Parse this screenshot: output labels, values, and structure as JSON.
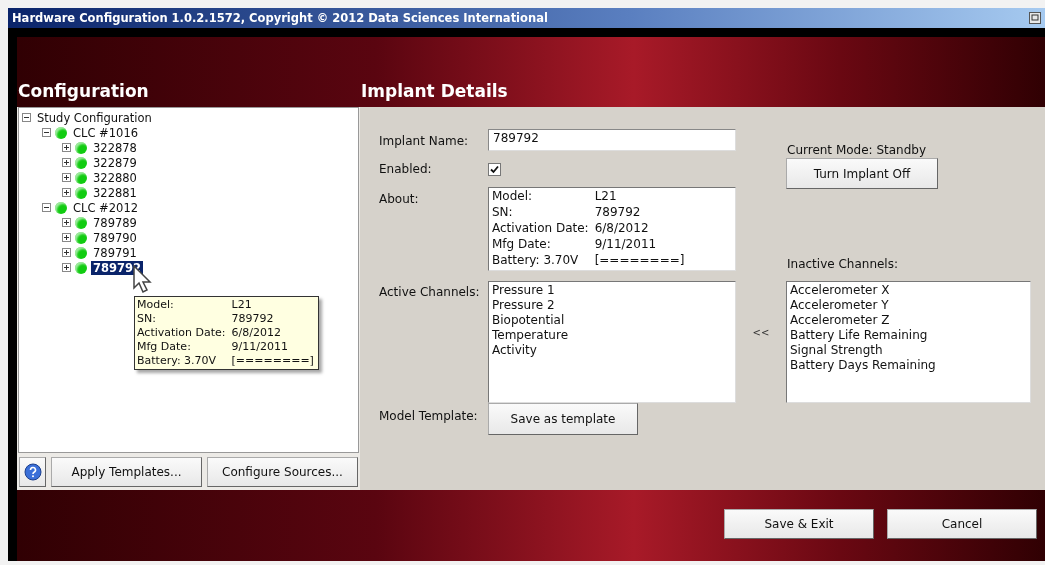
{
  "window": {
    "title": "Hardware Configuration 1.0.2.1572, Copyright © 2012 Data Sciences International"
  },
  "config_heading": "Configuration",
  "details_heading": "Implant Details",
  "tree": [
    {
      "label": "Study Configuration",
      "expanded": true,
      "selected": false,
      "children": [
        {
          "label": "CLC #1016",
          "color": "#11cc11",
          "expanded": true,
          "selected": false,
          "children": [
            {
              "label": "322878",
              "color": "#11cc11",
              "expanded": false,
              "selected": false
            },
            {
              "label": "322879",
              "color": "#11cc11",
              "expanded": false,
              "selected": false
            },
            {
              "label": "322880",
              "color": "#11cc11",
              "expanded": false,
              "selected": false
            },
            {
              "label": "322881",
              "color": "#11cc11",
              "expanded": false,
              "selected": false
            }
          ]
        },
        {
          "label": "CLC #2012",
          "color": "#11cc11",
          "expanded": true,
          "selected": false,
          "children": [
            {
              "label": "789789",
              "color": "#11cc11",
              "expanded": false,
              "selected": false
            },
            {
              "label": "789790",
              "color": "#11cc11",
              "expanded": false,
              "selected": false
            },
            {
              "label": "789791",
              "color": "#11cc11",
              "expanded": false,
              "selected": false
            },
            {
              "label": "789792",
              "color": "#11cc11",
              "expanded": false,
              "selected": true
            }
          ]
        }
      ]
    }
  ],
  "tooltip": {
    "rows": [
      {
        "label": "Model:",
        "value": "L21"
      },
      {
        "label": "SN:",
        "value": "789792"
      },
      {
        "label": "Activation Date:",
        "value": "6/8/2012"
      },
      {
        "label": "Mfg Date:",
        "value": "9/11/2011"
      },
      {
        "label": "Battery: 3.70V",
        "value": "[========]"
      }
    ]
  },
  "left_buttons": [
    "Apply Templates...",
    "Configure Sources..."
  ],
  "implant_name": {
    "label": "Implant Name:",
    "value": "789792"
  },
  "enabled": {
    "label": "Enabled:",
    "checked": true
  },
  "about": {
    "label": "About:",
    "rows": [
      {
        "label": "Model:",
        "value": "L21"
      },
      {
        "label": "SN:",
        "value": "789792"
      },
      {
        "label": "Activation Date:",
        "value": "6/8/2012"
      },
      {
        "label": "Mfg Date:",
        "value": "9/11/2011"
      },
      {
        "label": "Battery: 3.70V",
        "value": "[========]"
      }
    ]
  },
  "current_mode": "Current Mode: Standby",
  "turn_off_button": "Turn Implant Off",
  "active_channels": {
    "label": "Active Channels:",
    "items": [
      "Pressure 1",
      "Pressure 2",
      "Biopotential",
      "Temperature",
      "Activity"
    ]
  },
  "move_button": "<<",
  "inactive_channels": {
    "label": "Inactive Channels:",
    "items": [
      "Accelerometer X",
      "Accelerometer Y",
      "Accelerometer Z",
      "Battery Life Remaining",
      "Signal Strength",
      "Battery Days Remaining"
    ]
  },
  "model_template": {
    "label": "Model Template:",
    "button": "Save as template"
  },
  "footer_buttons": [
    "Save & Exit",
    "Cancel"
  ]
}
